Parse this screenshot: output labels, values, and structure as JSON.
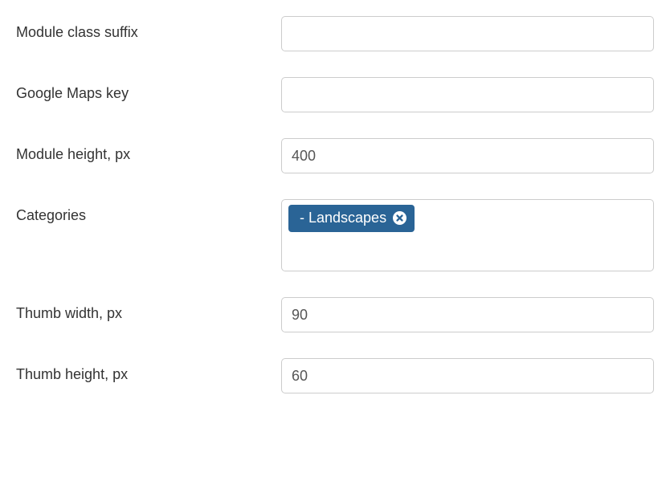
{
  "fields": {
    "module_class_suffix": {
      "label": "Module class suffix",
      "value": ""
    },
    "google_maps_key": {
      "label": "Google Maps key",
      "value": ""
    },
    "module_height": {
      "label": "Module height, px",
      "value": "400"
    },
    "categories": {
      "label": "Categories",
      "tags": [
        {
          "label": "- Landscapes"
        }
      ]
    },
    "thumb_width": {
      "label": "Thumb width, px",
      "value": "90"
    },
    "thumb_height": {
      "label": "Thumb height, px",
      "value": "60"
    }
  }
}
